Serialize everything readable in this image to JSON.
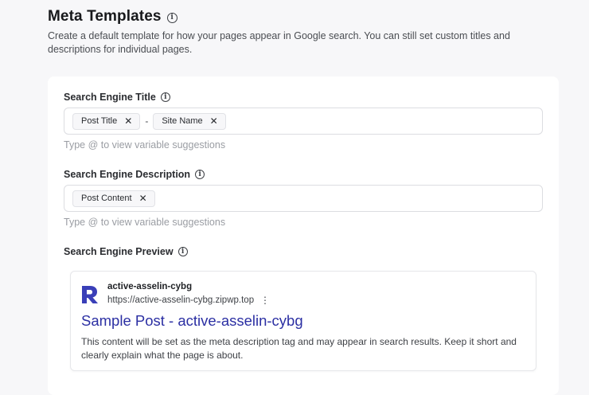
{
  "header": {
    "title": "Meta Templates",
    "description": "Create a default template for how your pages appear in Google search. You can still set custom titles and descriptions for individual pages."
  },
  "title_field": {
    "label": "Search Engine Title",
    "chips": [
      "Post Title",
      "Site Name"
    ],
    "separator": "-",
    "hint": "Type @ to view variable suggestions"
  },
  "description_field": {
    "label": "Search Engine Description",
    "chips": [
      "Post Content"
    ],
    "hint": "Type @ to view variable suggestions"
  },
  "preview": {
    "label": "Search Engine Preview",
    "site_name": "active-asselin-cybg",
    "site_url": "https://active-asselin-cybg.zipwp.top",
    "title": "Sample Post - active-asselin-cybg",
    "description": "This content will be set as the meta description tag and may appear in search results. Keep it short and clearly explain what the page is about."
  },
  "icons": {
    "info": "info-icon",
    "remove": "close-icon",
    "more": "more-vertical-icon",
    "logo": "site-logo"
  },
  "colors": {
    "preview_title": "#2b2fa3",
    "logo": "#3a3fb8"
  }
}
